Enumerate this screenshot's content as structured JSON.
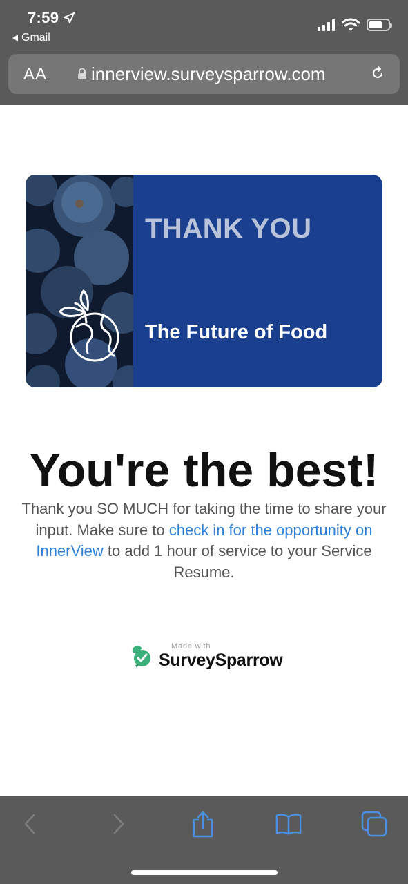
{
  "status_bar": {
    "time": "7:59",
    "back_app": "Gmail"
  },
  "address_bar": {
    "text_size_label": "AA",
    "url": "innerview.surveysparrow.com"
  },
  "banner": {
    "title": "THANK YOU",
    "subtitle": "The Future of Food"
  },
  "content": {
    "headline": "You're the best!",
    "message_before": "Thank you SO MUCH for taking the time to share your input. Make sure to ",
    "message_link": "check in for the opportunity on InnerView",
    "message_after": " to add 1 hour of service to your Service Resume."
  },
  "footer": {
    "made_with": "Made with",
    "brand": "SurveySparrow"
  },
  "colors": {
    "chrome": "#5a5a5a",
    "banner_blue": "#1b3f8f",
    "link": "#2e7fd6",
    "brand_green": "#3bb07a"
  },
  "icons": [
    "location-arrow-icon",
    "signal-icon",
    "wifi-icon",
    "battery-icon",
    "lock-icon",
    "reload-icon",
    "back-icon",
    "forward-icon",
    "share-icon",
    "bookmarks-icon",
    "tabs-icon",
    "globe-plant-icon",
    "surveysparrow-logo"
  ]
}
